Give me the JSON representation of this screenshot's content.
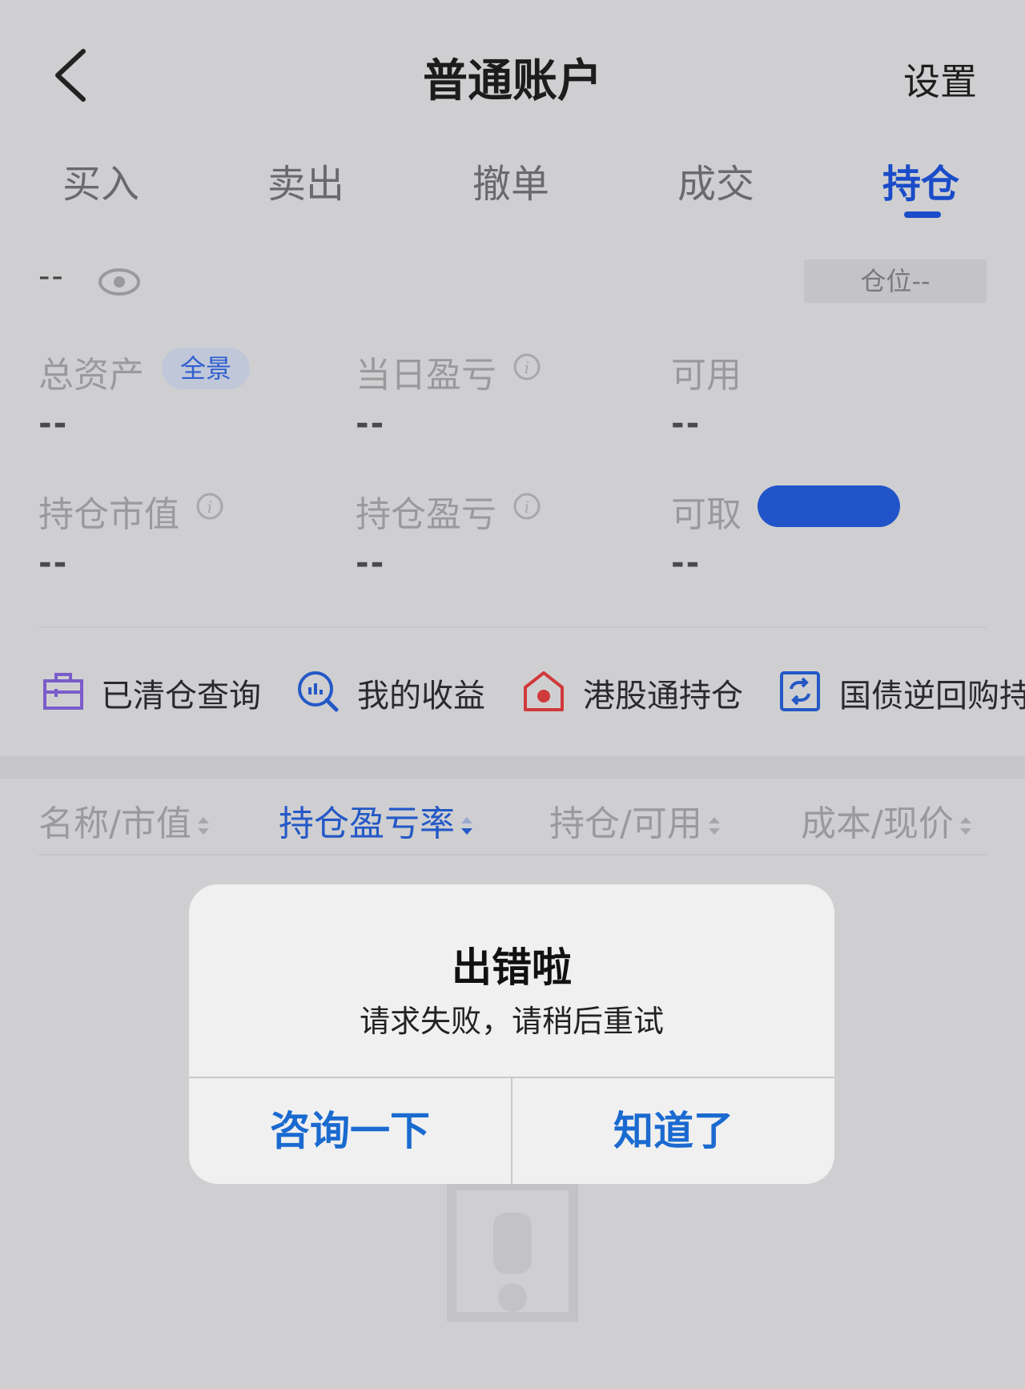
{
  "header": {
    "title": "普通账户",
    "settings_label": "设置"
  },
  "tabs": [
    {
      "label": "买入"
    },
    {
      "label": "卖出"
    },
    {
      "label": "撤单"
    },
    {
      "label": "成交"
    },
    {
      "label": "持仓",
      "active": true
    }
  ],
  "summary": {
    "balance": "--",
    "position_badge": "仓位--",
    "stats": [
      {
        "label": "总资产",
        "value": "--",
        "pill": "全景"
      },
      {
        "label": "当日盈亏",
        "value": "--"
      },
      {
        "label": "可用",
        "value": "--"
      },
      {
        "label": "持仓市值",
        "value": "--"
      },
      {
        "label": "持仓盈亏",
        "value": "--"
      },
      {
        "label": "可取",
        "value": "--"
      }
    ]
  },
  "shortcuts": [
    {
      "label": "已清仓查询",
      "icon": "briefcase-icon"
    },
    {
      "label": "我的收益",
      "icon": "chart-search-icon"
    },
    {
      "label": "港股通持仓",
      "icon": "hk-house-icon"
    },
    {
      "label": "国债逆回购持",
      "icon": "repeat-icon"
    }
  ],
  "table_headers": [
    {
      "label": "名称/市值"
    },
    {
      "label": "持仓盈亏率",
      "active": true
    },
    {
      "label": "持仓/可用"
    },
    {
      "label": "成本/现价"
    }
  ],
  "dialog": {
    "title": "出错啦",
    "message": "请求失败，请稍后重试",
    "buttons": [
      "咨询一下",
      "知道了"
    ]
  },
  "colors": {
    "accent": "#1a4cc9",
    "dialog_button": "#1a6ad0",
    "background": "#cfcfd1"
  }
}
